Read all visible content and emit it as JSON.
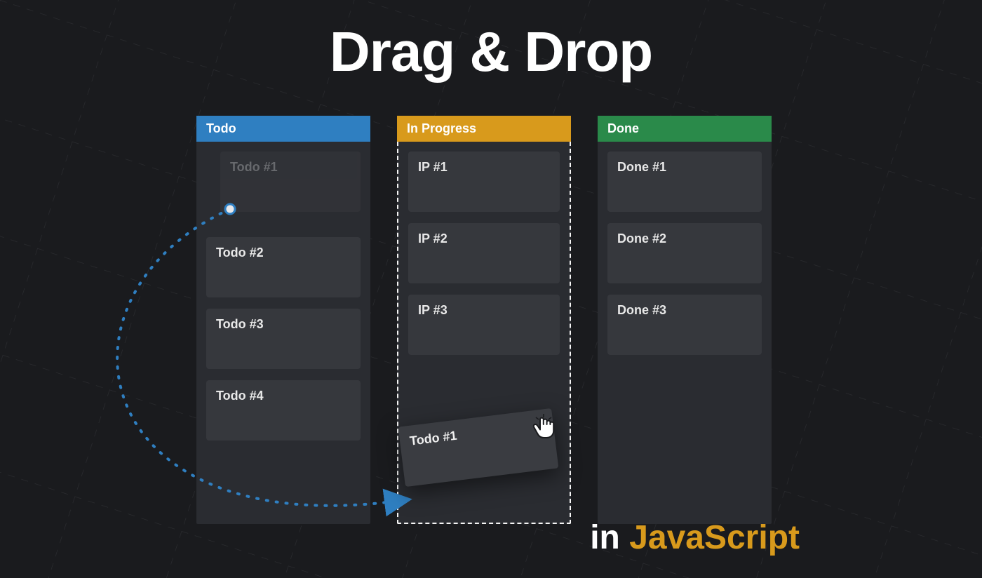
{
  "title": "Drag & Drop",
  "subtitle": {
    "prefix": "in",
    "highlight": "JavaScript"
  },
  "colors": {
    "todo": "#2f7fc1",
    "progress": "#d89a1c",
    "done": "#2a8a4a",
    "card_bg": "#36383d",
    "panel_bg": "#2a2c31",
    "page_bg": "#1a1b1e",
    "accent_path": "#2f7fc1"
  },
  "columns": [
    {
      "id": "todo",
      "title": "Todo",
      "cards": [
        {
          "label": "Todo #1",
          "ghost": true
        },
        {
          "label": "Todo #2"
        },
        {
          "label": "Todo #3"
        },
        {
          "label": "Todo #4"
        }
      ]
    },
    {
      "id": "progress",
      "title": "In Progress",
      "drop_active": true,
      "cards": [
        {
          "label": "IP #1"
        },
        {
          "label": "IP #2"
        },
        {
          "label": "IP #3"
        }
      ]
    },
    {
      "id": "done",
      "title": "Done",
      "cards": [
        {
          "label": "Done #1"
        },
        {
          "label": "Done #2"
        },
        {
          "label": "Done #3"
        }
      ]
    }
  ],
  "dragging": {
    "label": "Todo #1"
  }
}
